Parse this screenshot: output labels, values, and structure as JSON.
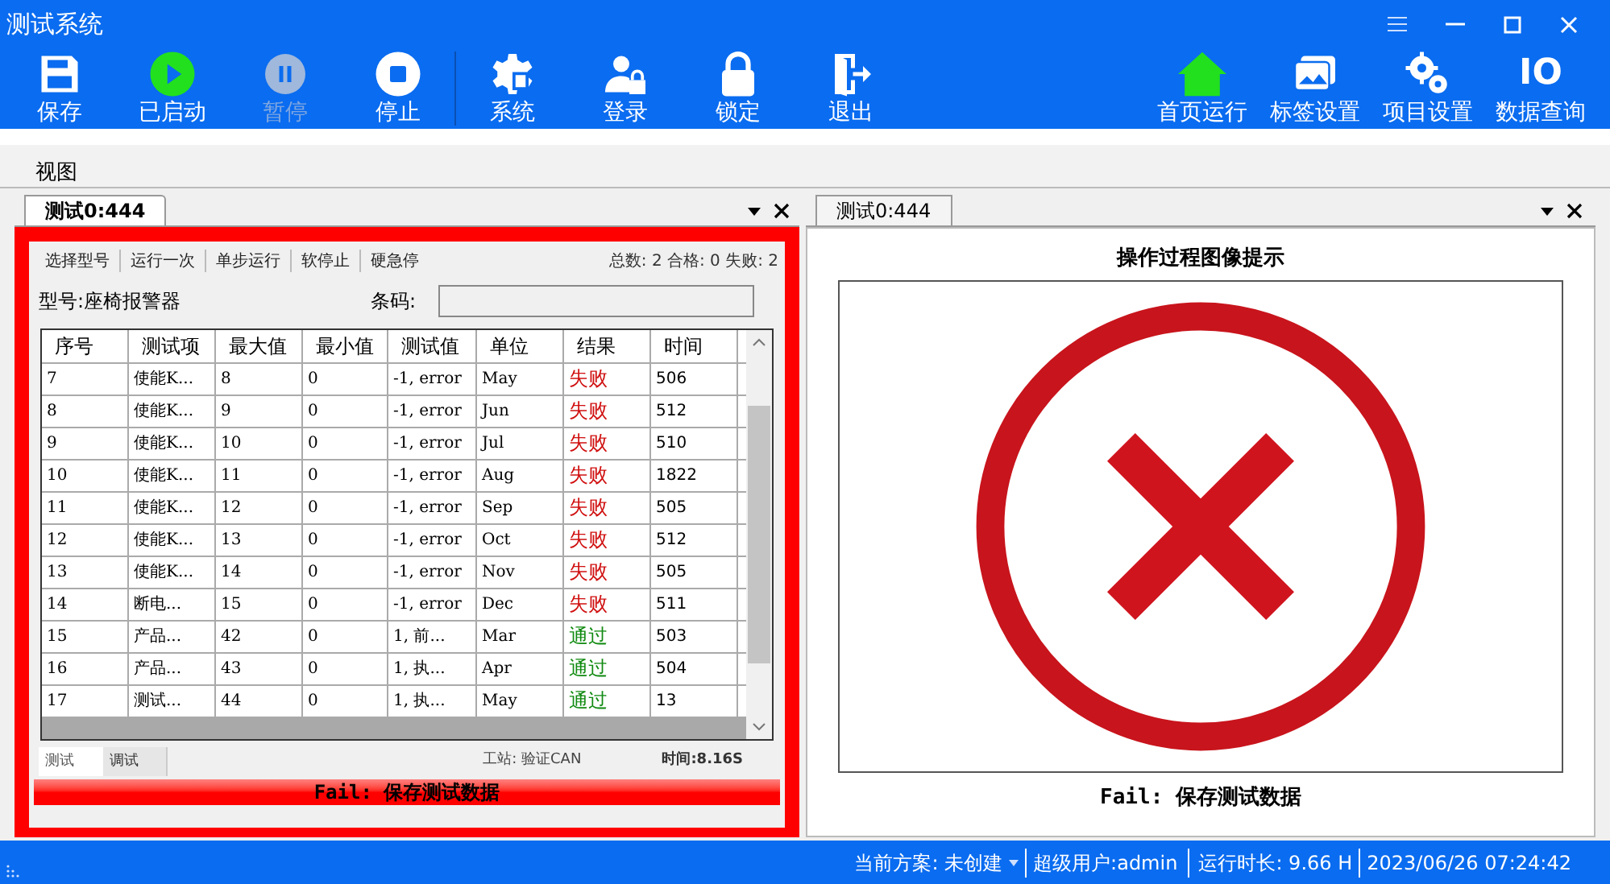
{
  "window": {
    "title": "测试系统"
  },
  "toolbar": [
    {
      "label": "保存",
      "active": false,
      "disabled": false
    },
    {
      "label": "已启动",
      "active": true,
      "disabled": false
    },
    {
      "label": "暂停",
      "active": false,
      "disabled": true
    },
    {
      "label": "停止",
      "active": false,
      "disabled": false
    },
    {
      "label": "系统",
      "active": false,
      "disabled": false
    },
    {
      "label": "登录",
      "active": false,
      "disabled": false
    },
    {
      "label": "锁定",
      "active": false,
      "disabled": false
    },
    {
      "label": "退出",
      "active": false,
      "disabled": false
    }
  ],
  "toolbar_right": [
    {
      "label": "首页运行",
      "active": true
    },
    {
      "label": "标签设置",
      "active": false
    },
    {
      "label": "项目设置",
      "active": false
    },
    {
      "label": "数据查询",
      "active": false,
      "icon_text": "IO"
    }
  ],
  "menu": [
    "视图"
  ],
  "left_panel": {
    "tab": "测试0:444",
    "actions": [
      "选择型号",
      "运行一次",
      "单步运行",
      "软停止",
      "硬急停"
    ],
    "counts": "总数: 2 合格: 0 失败: 2",
    "model": "型号:座椅报警器",
    "barcode_label": "条码:",
    "table": {
      "columns": [
        "序号",
        "测试项",
        "最大值",
        "最小值",
        "测试值",
        "单位",
        "结果",
        "时间"
      ],
      "rows": [
        {
          "cells": [
            "7",
            "使能K...",
            "8",
            "0",
            "-1, error",
            "May"
          ],
          "result": "失败",
          "passed": false,
          "time": "506"
        },
        {
          "cells": [
            "8",
            "使能K...",
            "9",
            "0",
            "-1, error",
            "Jun"
          ],
          "result": "失败",
          "passed": false,
          "time": "512"
        },
        {
          "cells": [
            "9",
            "使能K...",
            "10",
            "0",
            "-1, error",
            "Jul"
          ],
          "result": "失败",
          "passed": false,
          "time": "510"
        },
        {
          "cells": [
            "10",
            "使能K...",
            "11",
            "0",
            "-1, error",
            "Aug"
          ],
          "result": "失败",
          "passed": false,
          "time": "1822"
        },
        {
          "cells": [
            "11",
            "使能K...",
            "12",
            "0",
            "-1, error",
            "Sep"
          ],
          "result": "失败",
          "passed": false,
          "time": "505"
        },
        {
          "cells": [
            "12",
            "使能K...",
            "13",
            "0",
            "-1, error",
            "Oct"
          ],
          "result": "失败",
          "passed": false,
          "time": "512"
        },
        {
          "cells": [
            "13",
            "使能K...",
            "14",
            "0",
            "-1, error",
            "Nov"
          ],
          "result": "失败",
          "passed": false,
          "time": "505"
        },
        {
          "cells": [
            "14",
            "断电...",
            "15",
            "0",
            "-1, error",
            "Dec"
          ],
          "result": "失败",
          "passed": false,
          "time": "511"
        },
        {
          "cells": [
            "15",
            "产品...",
            "42",
            "0",
            "1, 前...",
            "Mar"
          ],
          "result": "通过",
          "passed": true,
          "time": "503"
        },
        {
          "cells": [
            "16",
            "产品...",
            "43",
            "0",
            "1, 执...",
            "Apr"
          ],
          "result": "通过",
          "passed": true,
          "time": "504"
        },
        {
          "cells": [
            "17",
            "测试...",
            "44",
            "0",
            "1, 执...",
            "May"
          ],
          "result": "通过",
          "passed": true,
          "time": "13"
        }
      ]
    },
    "bottom_tabs": [
      {
        "label": "测试",
        "selected": true
      },
      {
        "label": "调试",
        "selected": false
      }
    ],
    "station": "工站: 验证CAN",
    "elapsed": "时间:8.16S",
    "message": "Fail: 保存测试数据"
  },
  "right_panel": {
    "tab": "测试0:444",
    "heading": "操作过程图像提示",
    "caption": "Fail: 保存测试数据"
  },
  "status_bar": {
    "scheme": "当前方案: 未创建",
    "user": "超级用户:admin",
    "runtime": "运行时长: 9.66 H",
    "datetime": "2023/06/26 07:24:42"
  }
}
